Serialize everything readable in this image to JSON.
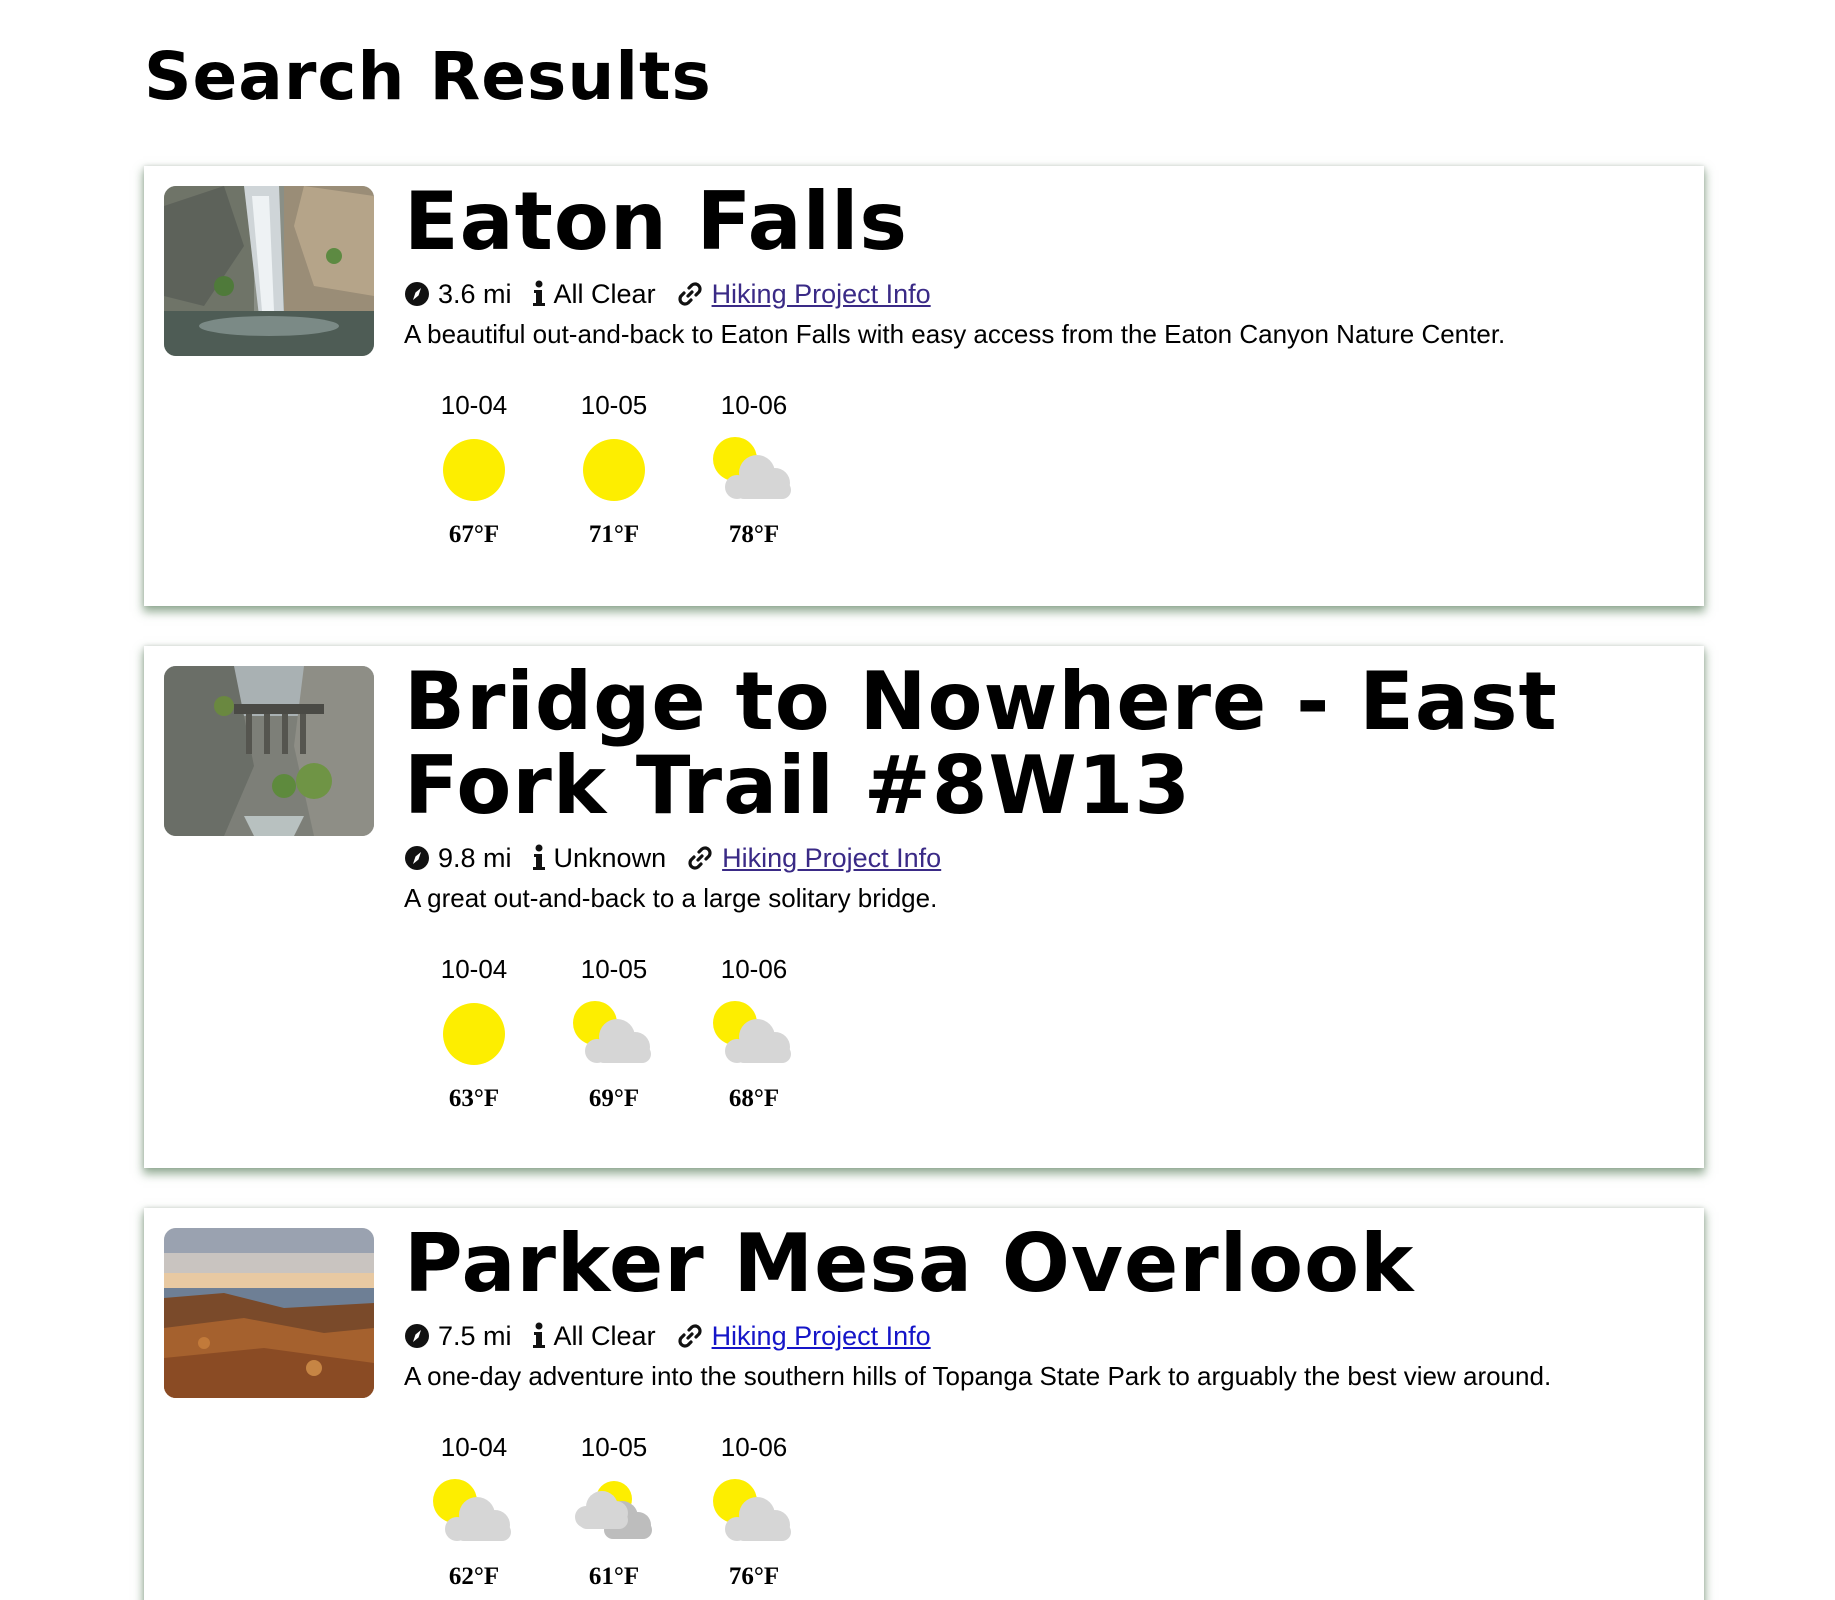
{
  "page": {
    "title": "Search Results"
  },
  "colors": {
    "sun": "#fdee00",
    "cloud": "#d6d6d6",
    "dark_cloud": "#bdbdbd",
    "link_visited": "#3a2a86",
    "link": "#1515c8",
    "shadow": "#3e6940"
  },
  "icons": {
    "distance": "compass-icon",
    "status": "info-icon",
    "link": "link-icon",
    "sunny": "sun-icon",
    "partly_cloudy": "partly-cloudy-icon",
    "cloudy": "cloudy-icon"
  },
  "trails": [
    {
      "name": "Eaton Falls",
      "distance": "3.6 mi",
      "status": "All Clear",
      "link_label": "Hiking Project Info",
      "description": "A beautiful out-and-back to Eaton Falls with easy access from the Eaton Canyon Nature Center.",
      "photo": "waterfall-photo",
      "forecast": [
        {
          "date": "10-04",
          "condition": "sunny",
          "temp": "67°F"
        },
        {
          "date": "10-05",
          "condition": "sunny",
          "temp": "71°F"
        },
        {
          "date": "10-06",
          "condition": "partly_cloudy",
          "temp": "78°F"
        }
      ]
    },
    {
      "name": "Bridge to Nowhere - East Fork Trail #8W13",
      "distance": "9.8 mi",
      "status": "Unknown",
      "link_label": "Hiking Project Info",
      "description": "A great out-and-back to a large solitary bridge.",
      "photo": "canyon-bridge-photo",
      "forecast": [
        {
          "date": "10-04",
          "condition": "sunny",
          "temp": "63°F"
        },
        {
          "date": "10-05",
          "condition": "partly_cloudy",
          "temp": "69°F"
        },
        {
          "date": "10-06",
          "condition": "partly_cloudy",
          "temp": "68°F"
        }
      ]
    },
    {
      "name": "Parker Mesa Overlook",
      "distance": "7.5 mi",
      "status": "All Clear",
      "link_label": "Hiking Project Info",
      "description": "A one-day adventure into the southern hills of Topanga State Park to arguably the best view around.",
      "photo": "coastal-overlook-photo",
      "forecast": [
        {
          "date": "10-04",
          "condition": "partly_cloudy",
          "temp": "62°F"
        },
        {
          "date": "10-05",
          "condition": "cloudy",
          "temp": "61°F"
        },
        {
          "date": "10-06",
          "condition": "partly_cloudy",
          "temp": "76°F"
        }
      ]
    }
  ]
}
